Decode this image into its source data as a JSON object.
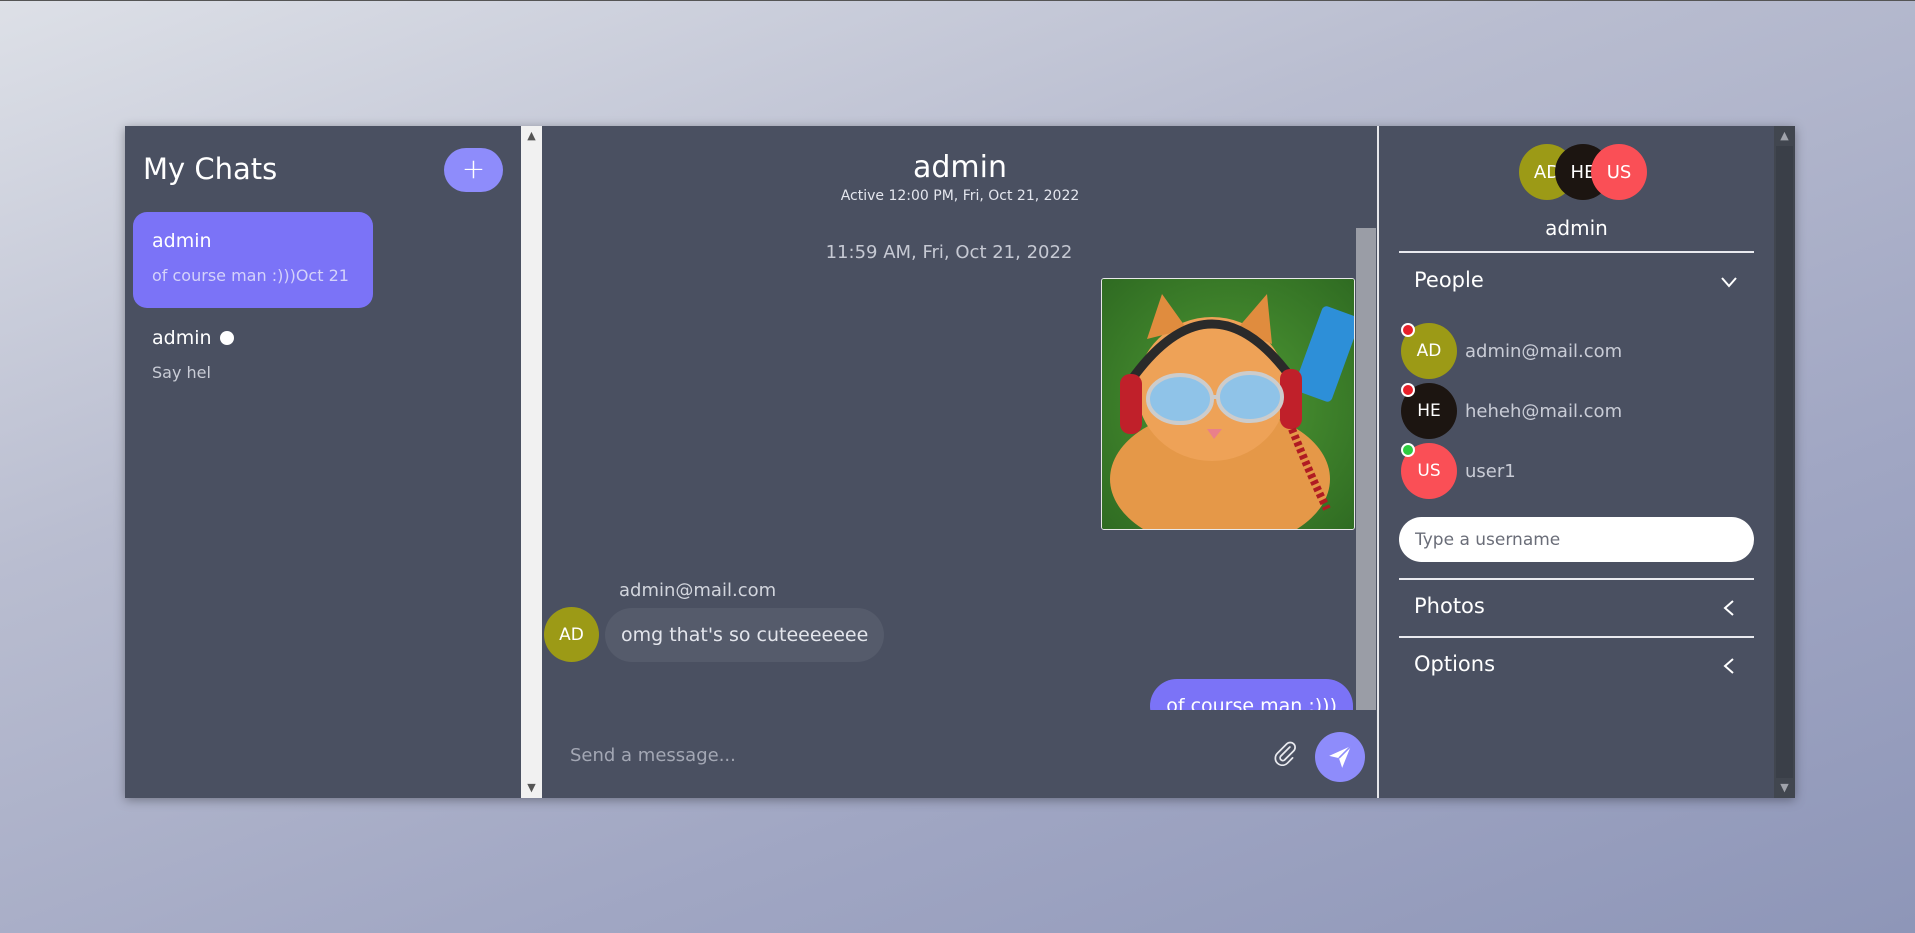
{
  "sidebar": {
    "title": "My Chats",
    "new_chat_label": "+",
    "chats": [
      {
        "name": "admin",
        "preview": "of course man :)))Oct 21",
        "active": true,
        "online": false
      },
      {
        "name": "admin",
        "preview": "Say hel",
        "active": false,
        "online": true
      }
    ]
  },
  "conversation": {
    "title": "admin",
    "status": "Active 12:00 PM, Fri, Oct 21, 2022",
    "timestamp": "11:59 AM, Fri, Oct 21, 2022",
    "image_alt": "cat with sunglasses and headphones",
    "messages": [
      {
        "sender_email": "admin@mail.com",
        "avatar": "AD",
        "text": "omg that's so cuteeeeeee",
        "outgoing": false
      },
      {
        "text": "of course man :)))",
        "outgoing": true
      }
    ],
    "composer_placeholder": "Send a message..."
  },
  "details": {
    "avatars": [
      "AD",
      "HE",
      "US"
    ],
    "name": "admin",
    "people_label": "People",
    "people": [
      {
        "initials": "AD",
        "email": "admin@mail.com",
        "status": "offline"
      },
      {
        "initials": "HE",
        "email": "heheh@mail.com",
        "status": "offline"
      },
      {
        "initials": "US",
        "email": "user1",
        "status": "online"
      }
    ],
    "username_placeholder": "Type a username",
    "photos_label": "Photos",
    "options_label": "Options"
  },
  "colors": {
    "panel": "#4a5061",
    "accent": "#7b73f7",
    "accent_light": "#8e8cfb",
    "avatar_ad": "#9c9a16",
    "avatar_he": "#1c1511",
    "avatar_us": "#fa4f56",
    "status_offline": "#e8202a",
    "status_online": "#2ecc40"
  }
}
